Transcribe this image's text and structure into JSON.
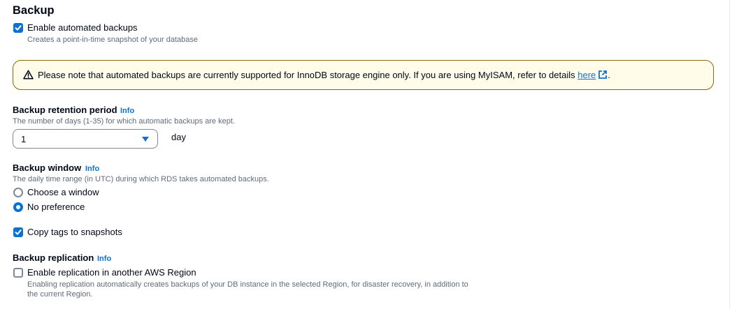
{
  "section": {
    "title": "Backup"
  },
  "automated_backups": {
    "label": "Enable automated backups",
    "description": "Creates a point-in-time snapshot of your database",
    "checked": true
  },
  "alert": {
    "icon": "warning-icon",
    "text": "Please note that automated backups are currently supported for InnoDB storage engine only. If you are using MyISAM, refer to details ",
    "link_text": "here",
    "link_icon": "external-link-icon",
    "after_link": "."
  },
  "retention": {
    "label": "Backup retention period",
    "info": "Info",
    "description": "The number of days (1-35) for which automatic backups are kept.",
    "value": "1",
    "unit": "day"
  },
  "window": {
    "label": "Backup window",
    "info": "Info",
    "description": "The daily time range (in UTC) during which RDS takes automated backups.",
    "options": [
      {
        "label": "Choose a window",
        "selected": false
      },
      {
        "label": "No preference",
        "selected": true
      }
    ]
  },
  "copy_tags": {
    "label": "Copy tags to snapshots",
    "checked": true
  },
  "replication": {
    "label": "Backup replication",
    "info": "Info",
    "checkbox_label": "Enable replication in another AWS Region",
    "checked": false,
    "description_line1": "Enabling replication automatically creates backups of your DB instance in the selected Region, for disaster recovery, in addition to",
    "description_line2": "the current Region."
  },
  "colors": {
    "accent": "#0972d3",
    "alert_background": "#fffce9",
    "alert_border": "#8d6605",
    "text": "#000716",
    "muted_text": "#5f6b7a"
  }
}
